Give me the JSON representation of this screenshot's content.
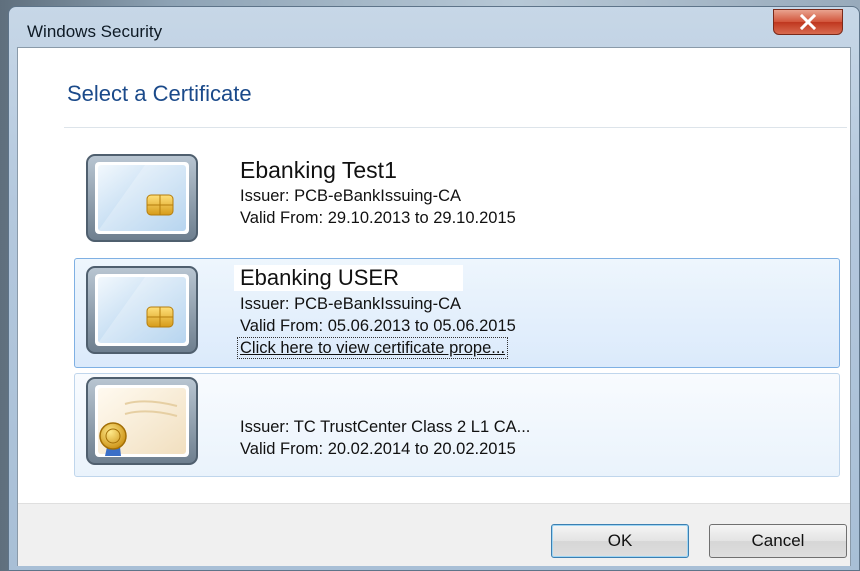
{
  "window": {
    "title": "Windows Security"
  },
  "dialog": {
    "heading": "Select a Certificate"
  },
  "certificates": [
    {
      "name": "Ebanking Test1",
      "issuer": "Issuer: PCB-eBankIssuing-CA",
      "valid": "Valid From: 29.10.2013 to 29.10.2015",
      "icon": "smartcard-chip-icon"
    },
    {
      "name": "Ebanking USER",
      "issuer": "Issuer: PCB-eBankIssuing-CA",
      "valid": "Valid From: 05.06.2013 to 05.06.2015",
      "link": "Click here to view certificate prope...",
      "icon": "smartcard-chip-icon",
      "selected": true
    },
    {
      "name": "",
      "issuer": "Issuer: TC TrustCenter Class 2 L1 CA...",
      "valid": "Valid From: 20.02.2014 to 20.02.2015",
      "icon": "certificate-seal-icon"
    }
  ],
  "buttons": {
    "ok": "OK",
    "cancel": "Cancel"
  },
  "colors": {
    "heading": "#1b4a8a",
    "selected_bg": "#dbeafb",
    "selected_border": "#7fb0e3",
    "close_button": "#c0371f"
  }
}
